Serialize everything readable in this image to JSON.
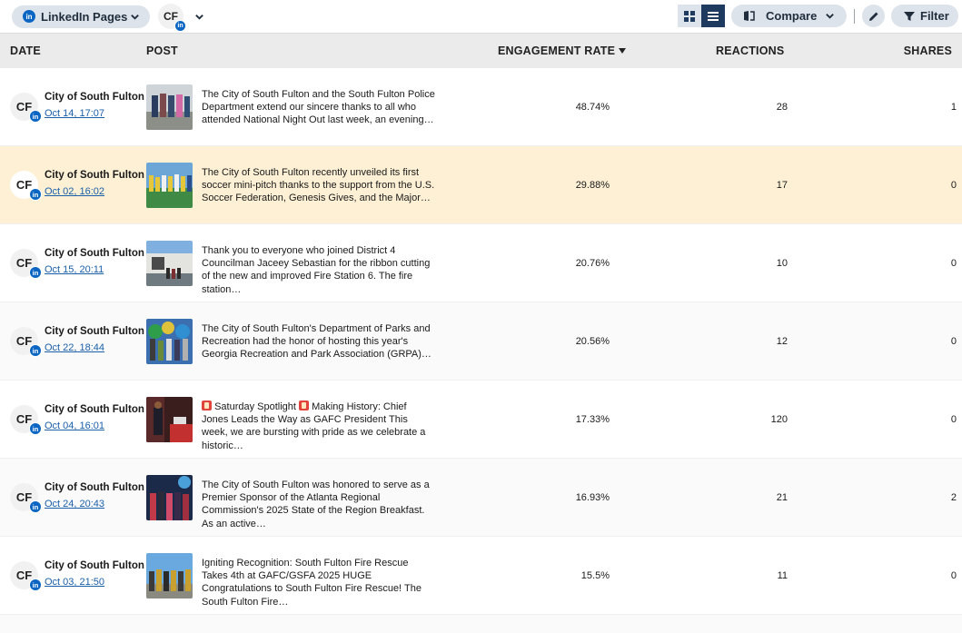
{
  "toolbar": {
    "pages_label": "LinkedIn Pages",
    "account_initials": "CF",
    "compare_label": "Compare",
    "filter_label": "Filter"
  },
  "table": {
    "headers": {
      "date": "DATE",
      "post": "POST",
      "engagement": "ENGAGEMENT RATE",
      "reactions": "REACTIONS",
      "shares": "SHARES"
    },
    "rows": [
      {
        "initials": "CF",
        "name": "City of South Fulton",
        "date": "Oct 14, 17:07",
        "text": "The City of South Fulton and the South Fulton Police Department extend our sincere thanks to all who attended National Night Out last week, an evening…",
        "engagement": "48.74%",
        "reactions": "28",
        "shares": "1",
        "highlight": false
      },
      {
        "initials": "CF",
        "name": "City of South Fulton",
        "date": "Oct 02, 16:02",
        "text": "The City of South Fulton recently unveiled its first soccer mini-pitch thanks to the support from the U.S. Soccer Federation, Genesis Gives, and the Major…",
        "engagement": "29.88%",
        "reactions": "17",
        "shares": "0",
        "highlight": true
      },
      {
        "initials": "CF",
        "name": "City of South Fulton",
        "date": "Oct 15, 20:11",
        "text": "Thank you to everyone who joined District 4 Councilman Jaceey Sebastian for the ribbon cutting of the new and improved Fire Station 6. The fire station…",
        "engagement": "20.76%",
        "reactions": "10",
        "shares": "0",
        "highlight": false
      },
      {
        "initials": "CF",
        "name": "City of South Fulton",
        "date": "Oct 22, 18:44",
        "text": "The City of South Fulton's Department of Parks and Recreation had the honor of hosting this year's Georgia Recreation and Park Association (GRPA)…",
        "engagement": "20.56%",
        "reactions": "12",
        "shares": "0",
        "highlight": false
      },
      {
        "initials": "CF",
        "name": "City of South Fulton",
        "date": "Oct 04, 16:01",
        "text_a": "Saturday Spotlight",
        "text_b": "Making History: Chief Jones Leads the Way as GAFC President This week, we are bursting with pride as we celebrate a historic…",
        "engagement": "17.33%",
        "reactions": "120",
        "shares": "0",
        "highlight": false
      },
      {
        "initials": "CF",
        "name": "City of South Fulton",
        "date": "Oct 24, 20:43",
        "text": "The City of South Fulton was honored to serve as a Premier Sponsor of the Atlanta Regional Commission's 2025 State of the Region Breakfast. As an active…",
        "engagement": "16.93%",
        "reactions": "21",
        "shares": "2",
        "highlight": false
      },
      {
        "initials": "CF",
        "name": "City of South Fulton",
        "date": "Oct 03, 21:50",
        "text": "Igniting Recognition: South Fulton Fire Rescue Takes 4th at GAFC/GSFA 2025 HUGE Congratulations to South Fulton Fire Rescue!  The South Fulton Fire…",
        "engagement": "15.5%",
        "reactions": "11",
        "shares": "0",
        "highlight": false
      }
    ]
  },
  "colors": {
    "linkedin": "#0a66c2",
    "highlight_row": "#fdf0d5",
    "toggle_active": "#1f3a5f",
    "pill_bg": "#dde3ea",
    "link": "#1a5fa8"
  }
}
